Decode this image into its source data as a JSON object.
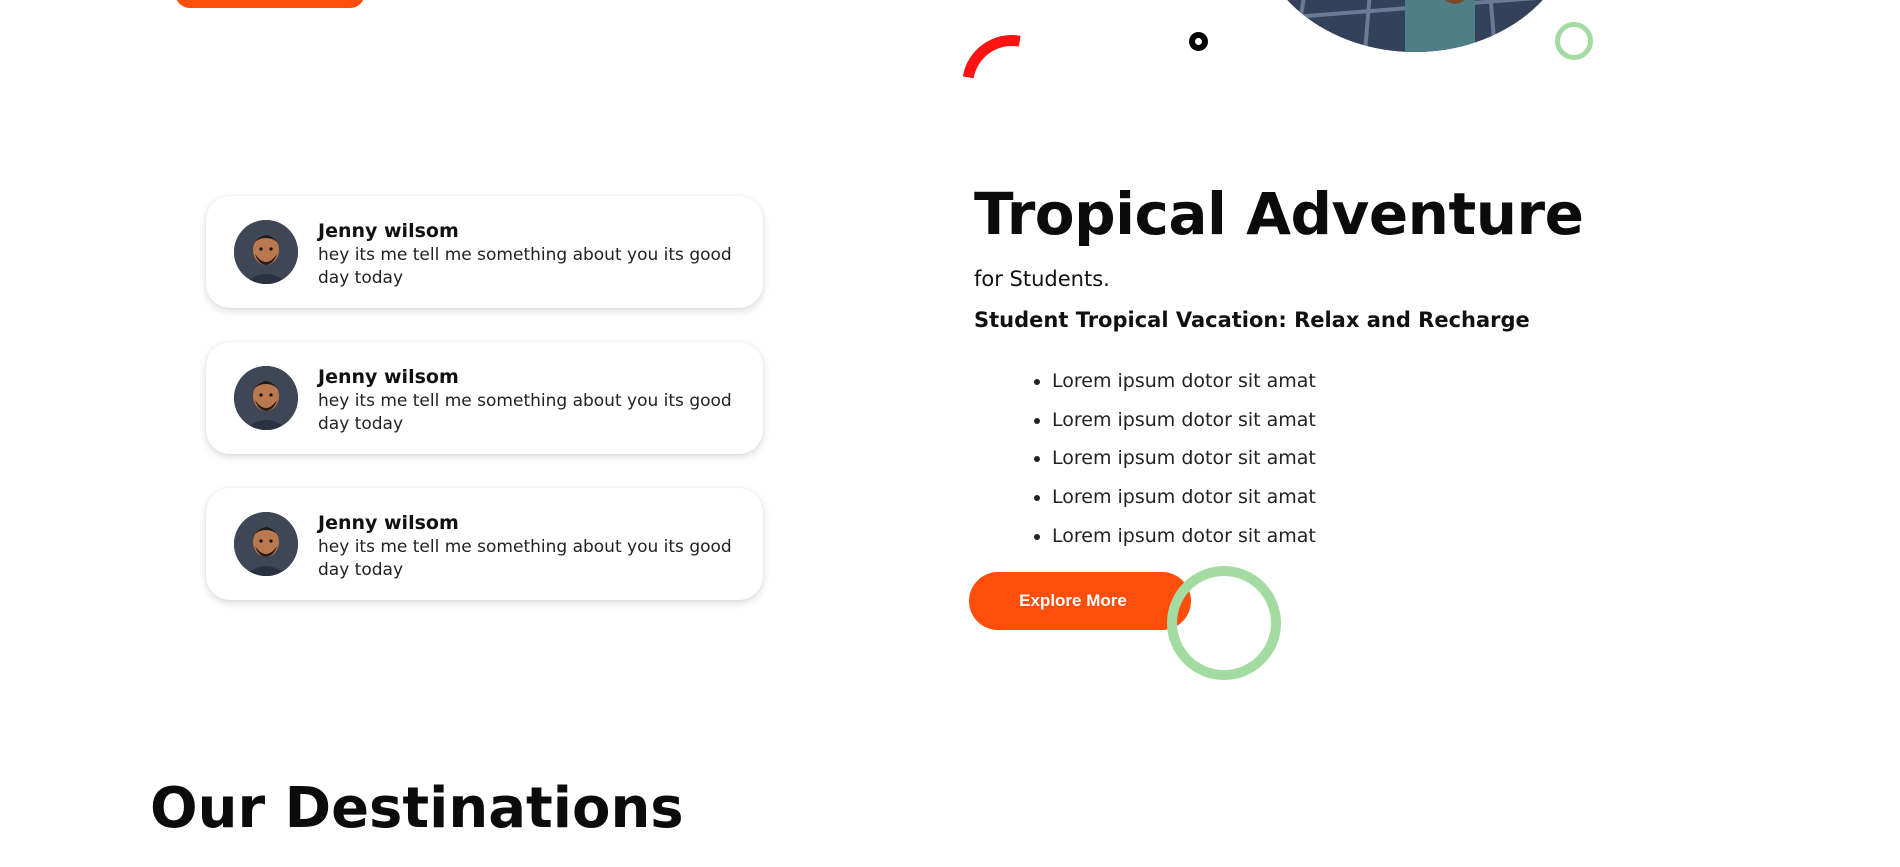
{
  "testimonials": [
    {
      "name": "Jenny wilsom",
      "message": "hey its me tell me something about you its good day today"
    },
    {
      "name": "Jenny wilsom",
      "message": "hey its me tell me something about you its good day today"
    },
    {
      "name": "Jenny wilsom",
      "message": "hey its me tell me something about you its good day today"
    }
  ],
  "feature": {
    "title": "Tropical Adventure",
    "subtitle": "for Students.",
    "tagline": "Student Tropical Vacation: Relax and Recharge",
    "bullets": [
      "Lorem ipsum dotor sit amat",
      "Lorem ipsum dotor sit amat",
      "Lorem ipsum dotor sit amat",
      "Lorem ipsum dotor sit amat",
      "Lorem ipsum dotor sit amat"
    ],
    "button_label": "Explore More"
  },
  "destinations": {
    "title": "Our Destinations"
  },
  "colors": {
    "accent": "#ff4d0a",
    "decor_red": "#ff1212",
    "decor_green": "#a4dba0",
    "text": "#111111"
  }
}
